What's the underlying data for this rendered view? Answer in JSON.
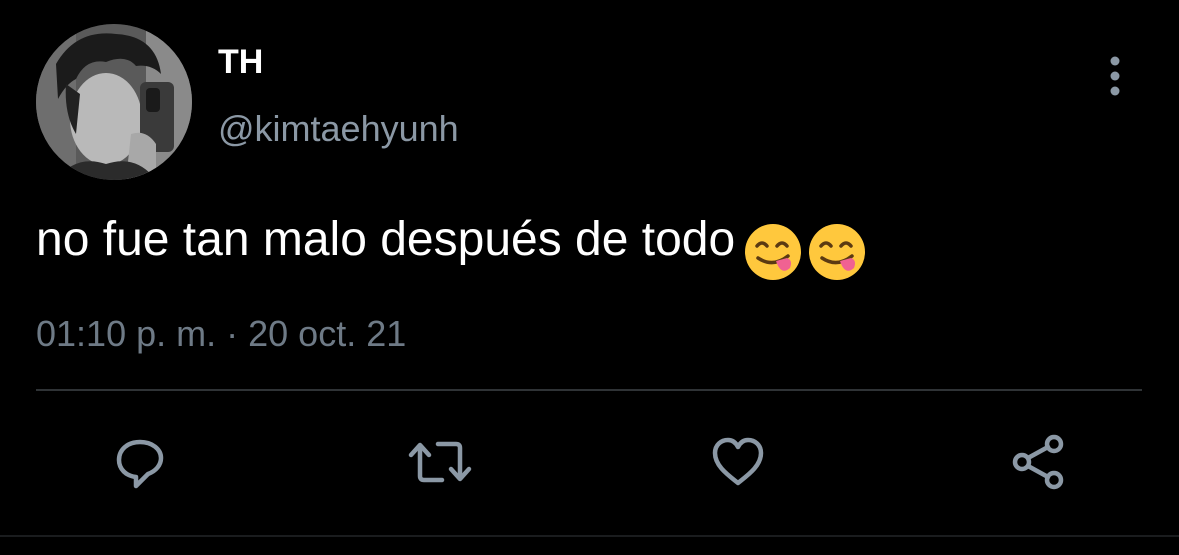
{
  "tweet": {
    "display_name": "TH",
    "handle": "@kimtaehyunh",
    "text": "no fue tan malo después de todo",
    "emojis": [
      "face-savoring-food-emoji",
      "face-savoring-food-emoji"
    ],
    "time": "01:10 p. m.",
    "separator": "·",
    "date": "20 oct. 21"
  },
  "actions": {
    "icons": [
      "reply-icon",
      "retweet-icon",
      "like-icon",
      "share-icon"
    ]
  },
  "colors": {
    "background": "#000000",
    "text_primary": "#ffffff",
    "text_secondary": "#8b98a5",
    "icon": "#8b98a5",
    "divider": "#2f3336",
    "emoji_face": "#ffc83d",
    "emoji_tongue": "#f06292"
  }
}
